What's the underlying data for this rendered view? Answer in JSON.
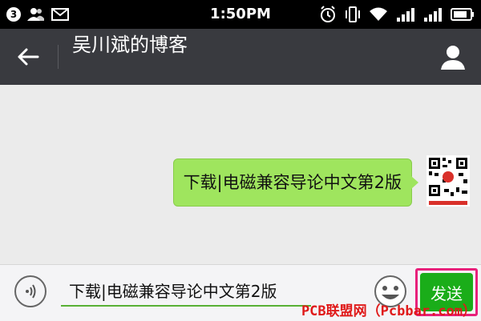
{
  "status_bar": {
    "notification_count": "3",
    "time": "1:50PM",
    "icons": [
      "notification-badge",
      "contacts-icon",
      "mail-icon",
      "alarm-icon",
      "vibrate-icon",
      "wifi-icon",
      "signal-icon",
      "signal-icon",
      "battery-icon"
    ]
  },
  "header": {
    "title": "吴川斌的博客",
    "back_icon": "arrow-left-icon",
    "profile_icon": "person-icon"
  },
  "messages": [
    {
      "text": "下载|电磁兼容导论中文第2版",
      "sender": "me"
    }
  ],
  "input_bar": {
    "value": "下载|电磁兼容导论中文第2版",
    "send_label": "发送",
    "voice_icon": "voice-icon",
    "emoji_icon": "emoji-icon"
  },
  "watermark": "PCB联盟网（Pcbbar.com）",
  "colors": {
    "status_bar": "#000000",
    "title_bar": "#393a3f",
    "chat_bg": "#ebebeb",
    "bubble": "#9fe55e",
    "send_button": "#1aad19",
    "highlight": "#e8207a",
    "watermark": "#e01a1a"
  }
}
